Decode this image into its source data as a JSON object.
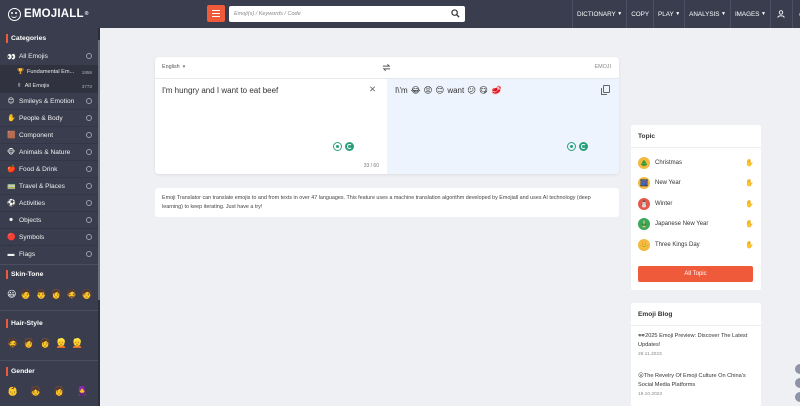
{
  "header": {
    "logo_text": "EMOJIALL",
    "logo_mark": "®",
    "search_placeholder": "Emoji(s) / Keywords / Code",
    "nav": [
      {
        "label": "DICTIONARY",
        "has_caret": true
      },
      {
        "label": "COPY",
        "has_caret": false
      },
      {
        "label": "PLAY",
        "has_caret": true
      },
      {
        "label": "ANALYSIS",
        "has_caret": true
      },
      {
        "label": "IMAGES",
        "has_caret": true
      }
    ],
    "user_icon": "user-icon",
    "lang_icon": "globe-icon"
  },
  "sidebar": {
    "categories_heading": "Categories",
    "all_emojis": {
      "emoji": "👀",
      "label": "All Emojis"
    },
    "sub_items": [
      {
        "emoji": "🏆",
        "label": "Fundamental Em...",
        "count": "1858"
      },
      {
        "emoji": "✌",
        "label": "All Emojis",
        "count": "3773"
      }
    ],
    "categories": [
      {
        "emoji": "😊",
        "label": "Smileys & Emotion"
      },
      {
        "emoji": "✋",
        "label": "People & Body"
      },
      {
        "emoji": "🟫",
        "label": "Component"
      },
      {
        "emoji": "🐵",
        "label": "Animals & Nature"
      },
      {
        "emoji": "🍎",
        "label": "Food & Drink"
      },
      {
        "emoji": "🚃",
        "label": "Travel & Places"
      },
      {
        "emoji": "⚽",
        "label": "Activities"
      },
      {
        "emoji": "⚫",
        "label": "Objects"
      },
      {
        "emoji": "🔴",
        "label": "Symbols"
      },
      {
        "emoji": "▬",
        "label": "Flags"
      }
    ],
    "skin_tone_heading": "Skin-Tone",
    "skin_tones": [
      "😃",
      "🧑",
      "👨",
      "👩",
      "🧔",
      "🧑"
    ],
    "hair_style_heading": "Hair-Style",
    "hair_styles": [
      "🧔",
      "👩",
      "👩",
      "👱",
      "👱"
    ],
    "gender_heading": "Gender",
    "genders": [
      "👶",
      "👧",
      "👩",
      "🧕"
    ]
  },
  "translator": {
    "source_lang": "English",
    "target_lang": "EMOJI",
    "source_text": "I'm hungry and I want to eat beef",
    "char_count": "33 / 60",
    "target_prefix": "I\\'m",
    "target_emojis_a": [
      "😂",
      "😡",
      "😊"
    ],
    "target_word": "want",
    "target_emojis_b": [
      "😕",
      "😋",
      "🥩"
    ]
  },
  "description": "Emoji Translator can translate emojis to and from texts in over 47 languages. This feature uses a machine translation algorithm developed by Emojiall and uses AI technology (deep learning) to keep iterating. Just have a try!",
  "topic": {
    "title": "Topic",
    "items": [
      {
        "emoji": "🎄",
        "label": "Christmas",
        "bg": "#f3b940"
      },
      {
        "emoji": "🎆",
        "label": "New Year",
        "bg": "#f3b940"
      },
      {
        "emoji": "⛄",
        "label": "Winter",
        "bg": "#e45a4a"
      },
      {
        "emoji": "🎍",
        "label": "Japanese New Year",
        "bg": "#3aa85a"
      },
      {
        "emoji": "👑",
        "label": "Three Kings Day",
        "bg": "#f3b940"
      }
    ],
    "hand": "✋",
    "button_label": "All Topic"
  },
  "blog": {
    "title": "Emoji Blog",
    "items": [
      {
        "title": "🕶2025 Emoji Preview: Discover The Latest Updates!",
        "date": "29.11.2023"
      },
      {
        "title": "😮The Revelry Of Emoji Culture On China's Social Media Platforms",
        "date": "19.10.2023"
      }
    ]
  },
  "colors": {
    "accent": "#ef5a3a",
    "header_bg": "#393d4e",
    "page_bg": "#eef0f4"
  }
}
